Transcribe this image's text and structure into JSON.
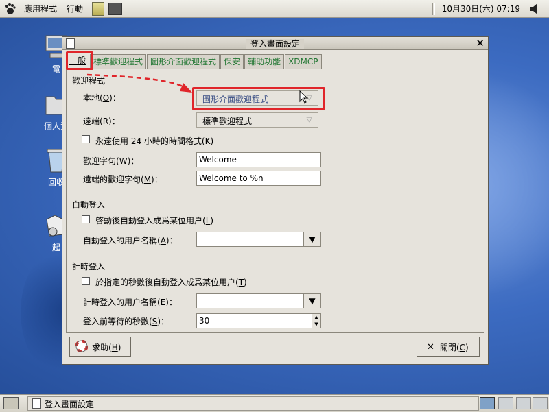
{
  "top_panel": {
    "menu_applications": "應用程式",
    "menu_actions": "行動",
    "clock": "10月30日(六) 07:19"
  },
  "desktop": {
    "icons": [
      {
        "label": "電"
      },
      {
        "label": "個人資"
      },
      {
        "label": "回收"
      },
      {
        "label": "起"
      }
    ]
  },
  "window": {
    "title": "登入畫面設定",
    "tabs": [
      "一般",
      "標準歡迎程式",
      "圖形介面歡迎程式",
      "保安",
      "輔助功能",
      "XDMCP"
    ],
    "general": {
      "section_greeter": "歡迎程式",
      "local_label_pre": "本地(",
      "local_label_key": "O",
      "local_label_post": ")：",
      "local_value": "圖形介面歡迎程式",
      "remote_label_pre": "遠端(",
      "remote_label_key": "R",
      "remote_label_post": ")：",
      "remote_value": "標準歡迎程式",
      "clock24_pre": "永遠使用 24 小時的時間格式(",
      "clock24_key": "K",
      "clock24_post": ")",
      "welcome_label_pre": "歡迎字句(",
      "welcome_label_key": "W",
      "welcome_label_post": ")：",
      "welcome_value": "Welcome",
      "remote_welcome_label_pre": "遠端的歡迎字句(",
      "remote_welcome_label_key": "M",
      "remote_welcome_label_post": ")：",
      "remote_welcome_value": "Welcome to %n",
      "section_autologin": "自動登入",
      "autologin_check_pre": "啓動後自動登入成爲某位用户(",
      "autologin_check_key": "L",
      "autologin_check_post": ")",
      "autologin_user_pre": "自動登入的用户名稱(",
      "autologin_user_key": "A",
      "autologin_user_post": ")：",
      "autologin_user_value": "",
      "section_timed": "計時登入",
      "timed_check_pre": "於指定的秒數後自動登入成爲某位用户(",
      "timed_check_key": "T",
      "timed_check_post": ")",
      "timed_user_pre": "計時登入的用户名稱(",
      "timed_user_key": "E",
      "timed_user_post": ")：",
      "timed_user_value": "",
      "timed_delay_pre": "登入前等待的秒數(",
      "timed_delay_key": "S",
      "timed_delay_post": ")：",
      "timed_delay_value": "30"
    },
    "help_pre": "求助(",
    "help_key": "H",
    "help_post": ")",
    "close_pre": "關閉(",
    "close_key": "C",
    "close_post": ")"
  },
  "taskbar": {
    "task_label": "登入畫面設定"
  },
  "colors": {
    "highlight": "#e0252a",
    "tab_text": "#227733",
    "desktop": "#3c6bc1"
  }
}
